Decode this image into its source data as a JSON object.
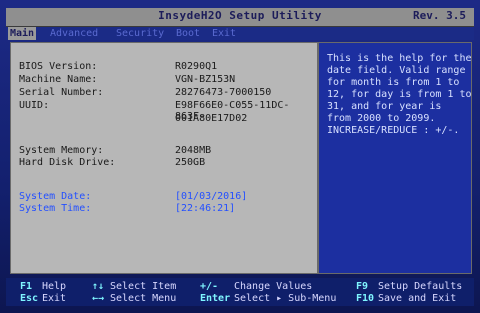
{
  "title": "InsydeH2O Setup Utility",
  "revision": "Rev. 3.5",
  "tabs": [
    "Main",
    "Advanced",
    "Security",
    "Boot",
    "Exit"
  ],
  "info": {
    "bios_label": "BIOS Version:",
    "bios_value": "R0290Q1",
    "machine_label": "Machine Name:",
    "machine_value": "VGN-BZ153N",
    "serial_label": "Serial Number:",
    "serial_value": "28276473-7000150",
    "uuid_label": "UUID:",
    "uuid_value_1": "E98F66E0-C055-11DC-863F-",
    "uuid_value_2": "001A80E17D02",
    "memory_label": "System Memory:",
    "memory_value": "2048MB",
    "hdd_label": "Hard Disk Drive:",
    "hdd_value": "250GB",
    "date_label": "System Date:",
    "date_value": "[01/03/2016]",
    "time_label": "System Time:",
    "time_value": "[22:46:21]"
  },
  "help": {
    "lines": [
      "This is the help for the",
      "date field. Valid range",
      "for month is from 1 to",
      "12, for day is from 1 to",
      "31, and for year is",
      "from 2000 to 2099.",
      "INCREASE/REDUCE : +/-."
    ]
  },
  "footer": {
    "f1_key": "F1",
    "f1_desc": "Help",
    "esc_key": "Esc",
    "esc_desc": "Exit",
    "updown_key": "↑↓",
    "updown_desc": "Select Item",
    "leftright_key": "←→",
    "leftright_desc": "Select Menu",
    "plusminus_key": "+/-",
    "plusminus_desc": "Change Values",
    "enter_key": "Enter",
    "enter_desc": "Select ▸ Sub-Menu",
    "f9_key": "F9",
    "f9_desc": "Setup Defaults",
    "f10_key": "F10",
    "f10_desc": "Save and Exit"
  }
}
